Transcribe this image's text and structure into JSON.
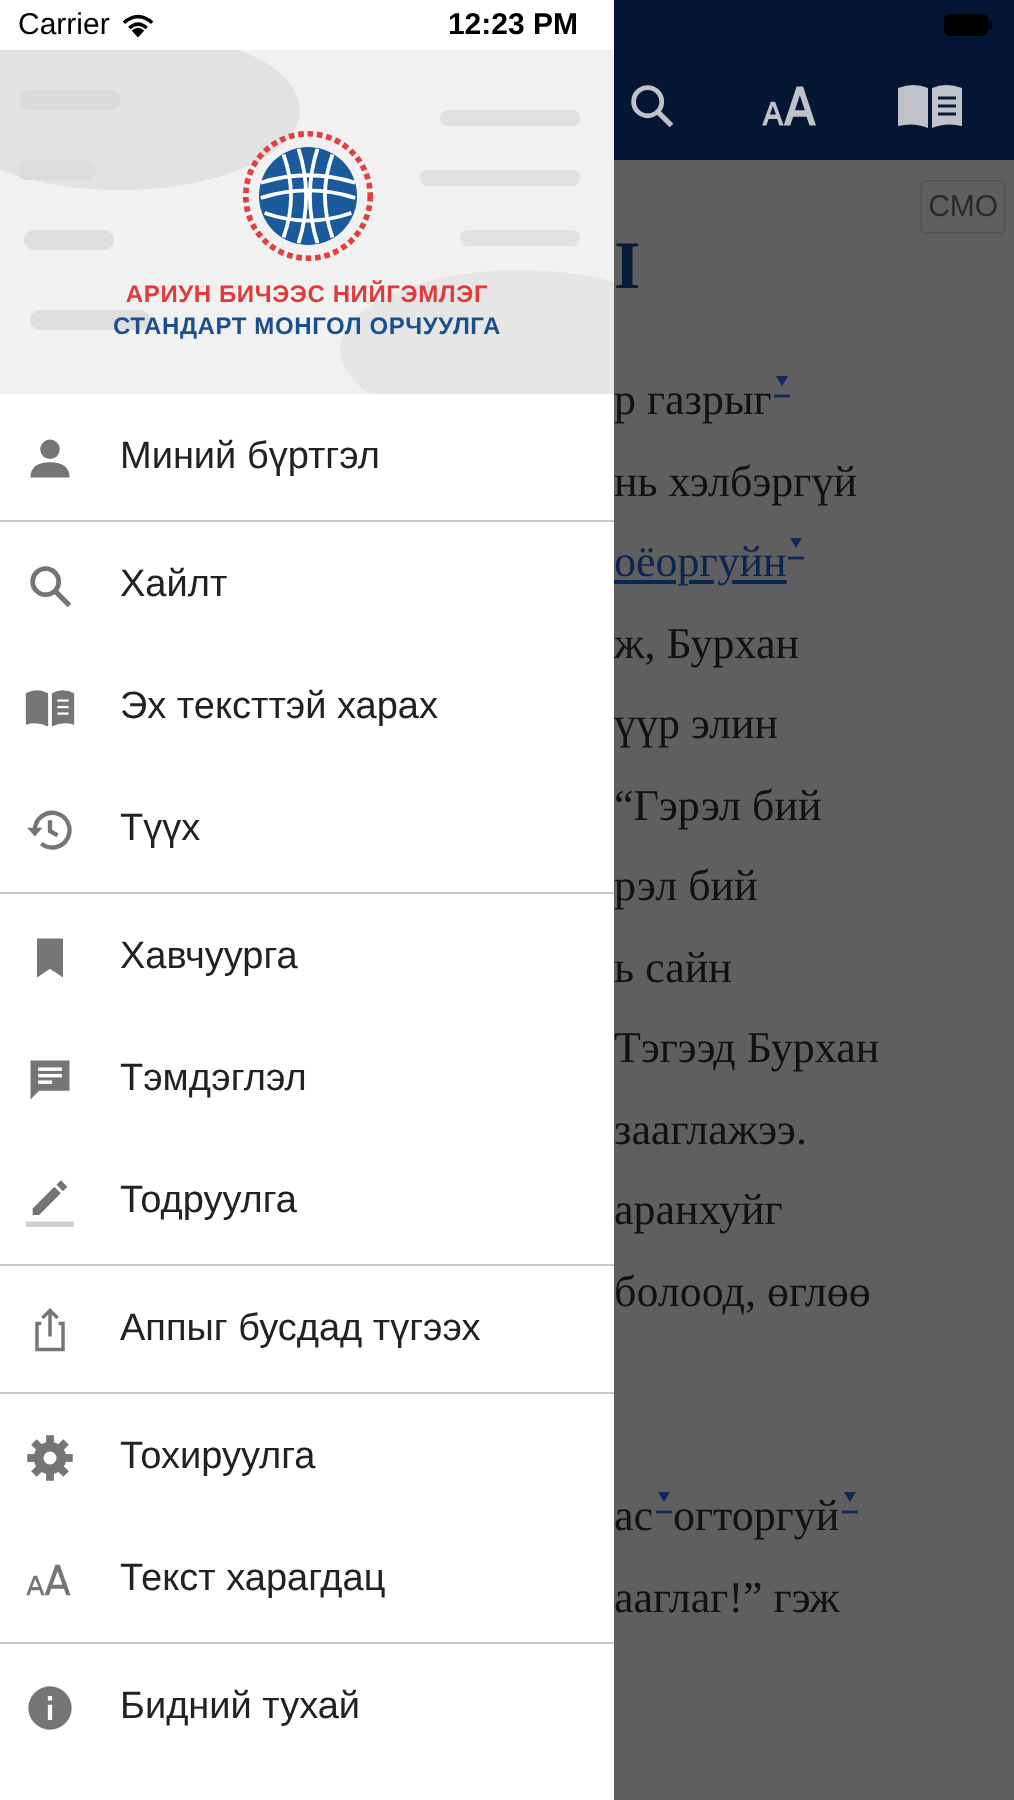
{
  "status_bar": {
    "carrier": "Carrier",
    "time": "12:23 PM"
  },
  "drawer": {
    "logo": {
      "line_1": "АРИУН БИЧЭЭС НИЙГЭМЛЭГ",
      "line_2": "СТАНДАРТ МОНГОЛ ОРЧУУЛГА"
    },
    "groups": [
      [
        {
          "kind": "account",
          "label": "Миний бүртгэл"
        }
      ],
      [
        {
          "kind": "search",
          "label": "Хайлт"
        },
        {
          "kind": "parallel",
          "label": "Эх тексттэй харах"
        },
        {
          "kind": "history",
          "label": "Түүх"
        }
      ],
      [
        {
          "kind": "bookmark",
          "label": "Хавчуурга"
        },
        {
          "kind": "note",
          "label": "Тэмдэглэл"
        },
        {
          "kind": "highlight",
          "label": "Тодруулга"
        }
      ],
      [
        {
          "kind": "share",
          "label": "Аппыг бусдад түгээх"
        }
      ],
      [
        {
          "kind": "settings",
          "label": "Тохируулга"
        },
        {
          "kind": "text-size",
          "label": "Текст харагдац"
        }
      ],
      [
        {
          "kind": "info",
          "label": "Бидний тухай"
        }
      ]
    ]
  },
  "reader": {
    "version_button": "СМО",
    "heading": "I",
    "paragraphs": [
      [
        [
          {
            "text": "р газрыг",
            "link": false,
            "footnote": true
          }
        ],
        [
          {
            "text": "нь хэлбэргүй",
            "link": false,
            "footnote": false
          }
        ],
        [
          {
            "text": "оёоргуйн",
            "link": true,
            "footnote": true
          }
        ],
        [
          {
            "text": "ж, Бурхан",
            "link": false,
            "footnote": false
          }
        ],
        [
          {
            "text": "үүр элин",
            "link": false,
            "footnote": false
          }
        ],
        [
          {
            "text": "“Гэрэл бий",
            "link": false,
            "footnote": false
          }
        ],
        [
          {
            "text": "рэл бий",
            "link": false,
            "footnote": false
          }
        ],
        [
          {
            "text": "ь сайн",
            "link": false,
            "footnote": false
          }
        ],
        [
          {
            "text": "Тэгээд Бурхан",
            "link": false,
            "footnote": false
          }
        ],
        [
          {
            "text": "зааглажээ.",
            "link": false,
            "footnote": false
          }
        ],
        [
          {
            "text": "аранхуйг",
            "link": false,
            "footnote": false
          }
        ],
        [
          {
            "text": "болоод, өглөө",
            "link": false,
            "footnote": false
          }
        ]
      ],
      [
        [
          {
            "text": "ас",
            "link": false,
            "footnote": true
          },
          {
            "text": "огторгуй",
            "link": false,
            "footnote": true
          }
        ],
        [
          {
            "text": "ааглаг!” гэж",
            "link": false,
            "footnote": false
          }
        ]
      ]
    ]
  }
}
